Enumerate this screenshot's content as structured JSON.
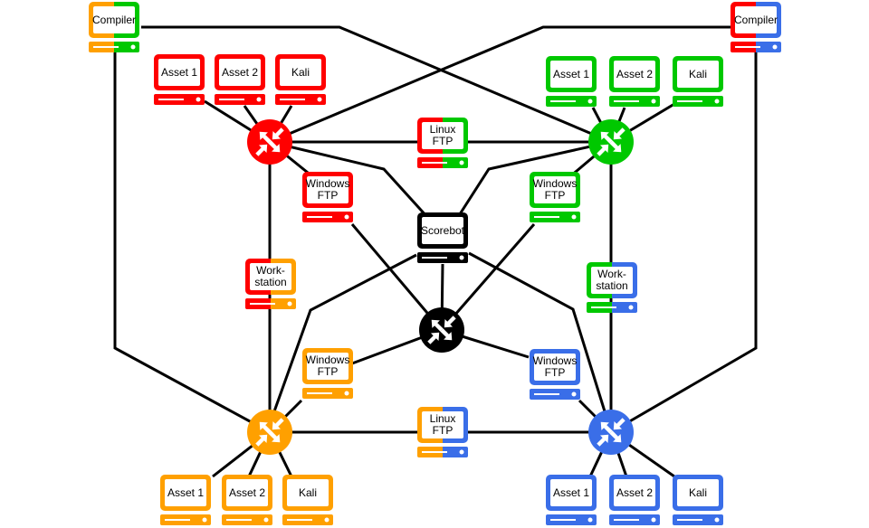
{
  "colors": {
    "red": "#ff0000",
    "green": "#00c800",
    "orange": "#ffa000",
    "blue": "#3a6ee8",
    "black": "#000000",
    "link": "#000000"
  },
  "nodes": [
    {
      "id": "compiler_left",
      "label": [
        "Compiler"
      ],
      "colors": [
        "orange",
        "green"
      ]
    },
    {
      "id": "compiler_right",
      "label": [
        "Compiler"
      ],
      "colors": [
        "red",
        "blue"
      ]
    },
    {
      "id": "red_asset1",
      "label": [
        "Asset 1"
      ],
      "colors": [
        "red",
        "red"
      ]
    },
    {
      "id": "red_asset2",
      "label": [
        "Asset 2"
      ],
      "colors": [
        "red",
        "red"
      ]
    },
    {
      "id": "red_kali",
      "label": [
        "Kali"
      ],
      "colors": [
        "red",
        "red"
      ]
    },
    {
      "id": "green_asset1",
      "label": [
        "Asset 1"
      ],
      "colors": [
        "green",
        "green"
      ]
    },
    {
      "id": "green_asset2",
      "label": [
        "Asset 2"
      ],
      "colors": [
        "green",
        "green"
      ]
    },
    {
      "id": "green_kali",
      "label": [
        "Kali"
      ],
      "colors": [
        "green",
        "green"
      ]
    },
    {
      "id": "linux_ftp_top",
      "label": [
        "Linux",
        "FTP"
      ],
      "colors": [
        "red",
        "green"
      ]
    },
    {
      "id": "windows_ftp_red",
      "label": [
        "Windows",
        "FTP"
      ],
      "colors": [
        "red",
        "red"
      ]
    },
    {
      "id": "windows_ftp_green",
      "label": [
        "Windows",
        "FTP"
      ],
      "colors": [
        "green",
        "green"
      ]
    },
    {
      "id": "scorebot",
      "label": [
        "Scorebot"
      ],
      "colors": [
        "black",
        "black"
      ]
    },
    {
      "id": "workstation_left",
      "label": [
        "Work-",
        "station"
      ],
      "colors": [
        "red",
        "orange"
      ]
    },
    {
      "id": "workstation_right",
      "label": [
        "Work-",
        "station"
      ],
      "colors": [
        "green",
        "blue"
      ]
    },
    {
      "id": "windows_ftp_orange",
      "label": [
        "Windows",
        "FTP"
      ],
      "colors": [
        "orange",
        "orange"
      ]
    },
    {
      "id": "windows_ftp_blue",
      "label": [
        "Windows",
        "FTP"
      ],
      "colors": [
        "blue",
        "blue"
      ]
    },
    {
      "id": "linux_ftp_bottom",
      "label": [
        "Linux",
        "FTP"
      ],
      "colors": [
        "orange",
        "blue"
      ]
    },
    {
      "id": "orange_asset1",
      "label": [
        "Asset 1"
      ],
      "colors": [
        "orange",
        "orange"
      ]
    },
    {
      "id": "orange_asset2",
      "label": [
        "Asset 2"
      ],
      "colors": [
        "orange",
        "orange"
      ]
    },
    {
      "id": "orange_kali",
      "label": [
        "Kali"
      ],
      "colors": [
        "orange",
        "orange"
      ]
    },
    {
      "id": "blue_asset1",
      "label": [
        "Asset 1"
      ],
      "colors": [
        "blue",
        "blue"
      ]
    },
    {
      "id": "blue_asset2",
      "label": [
        "Asset 2"
      ],
      "colors": [
        "blue",
        "blue"
      ]
    },
    {
      "id": "blue_kali",
      "label": [
        "Kali"
      ],
      "colors": [
        "blue",
        "blue"
      ]
    }
  ],
  "routers": [
    {
      "id": "router_red",
      "color": "red",
      "icon": "router-icon"
    },
    {
      "id": "router_green",
      "color": "green",
      "icon": "router-icon"
    },
    {
      "id": "router_black",
      "color": "black",
      "icon": "router-icon"
    },
    {
      "id": "router_orange",
      "color": "orange",
      "icon": "router-icon"
    },
    {
      "id": "router_blue",
      "color": "blue",
      "icon": "router-icon"
    }
  ]
}
